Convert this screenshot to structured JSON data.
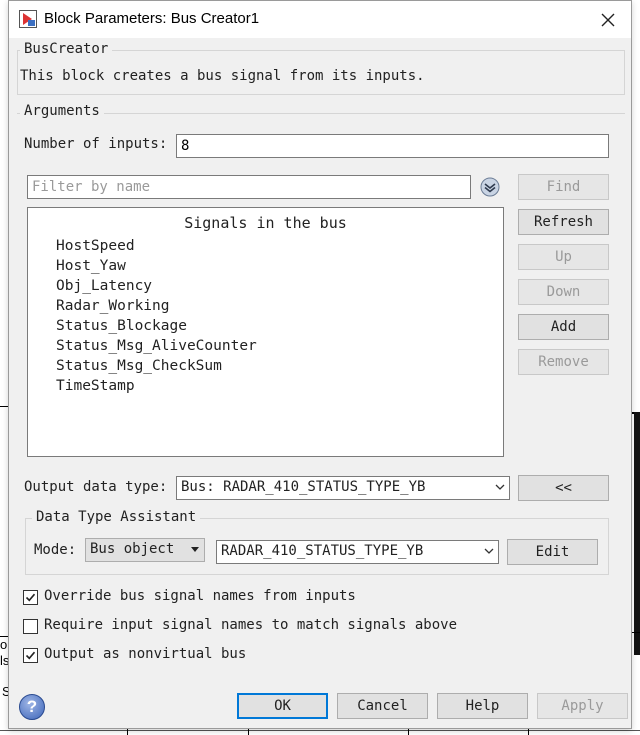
{
  "window": {
    "title": "Block Parameters: Bus Creator1"
  },
  "bus_creator": {
    "group_label": "BusCreator",
    "description": "This block creates a bus signal from its inputs."
  },
  "arguments": {
    "group_label": "Arguments",
    "num_inputs_label": "Number of inputs:",
    "num_inputs_value": "8",
    "filter_placeholder": "Filter by name",
    "signals_header": "Signals in the bus",
    "signals": [
      "HostSpeed",
      "Host_Yaw",
      "Obj_Latency",
      "Radar_Working",
      "Status_Blockage",
      "Status_Msg_AliveCounter",
      "Status_Msg_CheckSum",
      "TimeStamp"
    ],
    "buttons": {
      "find": "Find",
      "refresh": "Refresh",
      "up": "Up",
      "down": "Down",
      "add": "Add",
      "remove": "Remove"
    },
    "output_type_label": "Output data type:",
    "output_type_value": "Bus: RADAR_410_STATUS_TYPE_YB",
    "assistant_toggle": "<<"
  },
  "assistant": {
    "group_label": "Data Type Assistant",
    "mode_label": "Mode:",
    "mode_value": "Bus object",
    "bus_object_value": "RADAR_410_STATUS_TYPE_YB",
    "edit_button": "Edit"
  },
  "options": [
    {
      "label": "Override bus signal names from inputs",
      "checked": true
    },
    {
      "label": "Require input signal names to match signals above",
      "checked": false
    },
    {
      "label": "Output as nonvirtual bus",
      "checked": true
    }
  ],
  "footer": {
    "help_icon_glyph": "?",
    "ok": "OK",
    "cancel": "Cancel",
    "help": "Help",
    "apply": "Apply"
  },
  "background": {
    "fragment_1": "o",
    "fragment_2": "ls",
    "fragment_3": "S"
  },
  "colors": {
    "dialog_bg": "#f0f0f0",
    "accent": "#0078d7",
    "disabled_text": "#9a9a9a"
  }
}
